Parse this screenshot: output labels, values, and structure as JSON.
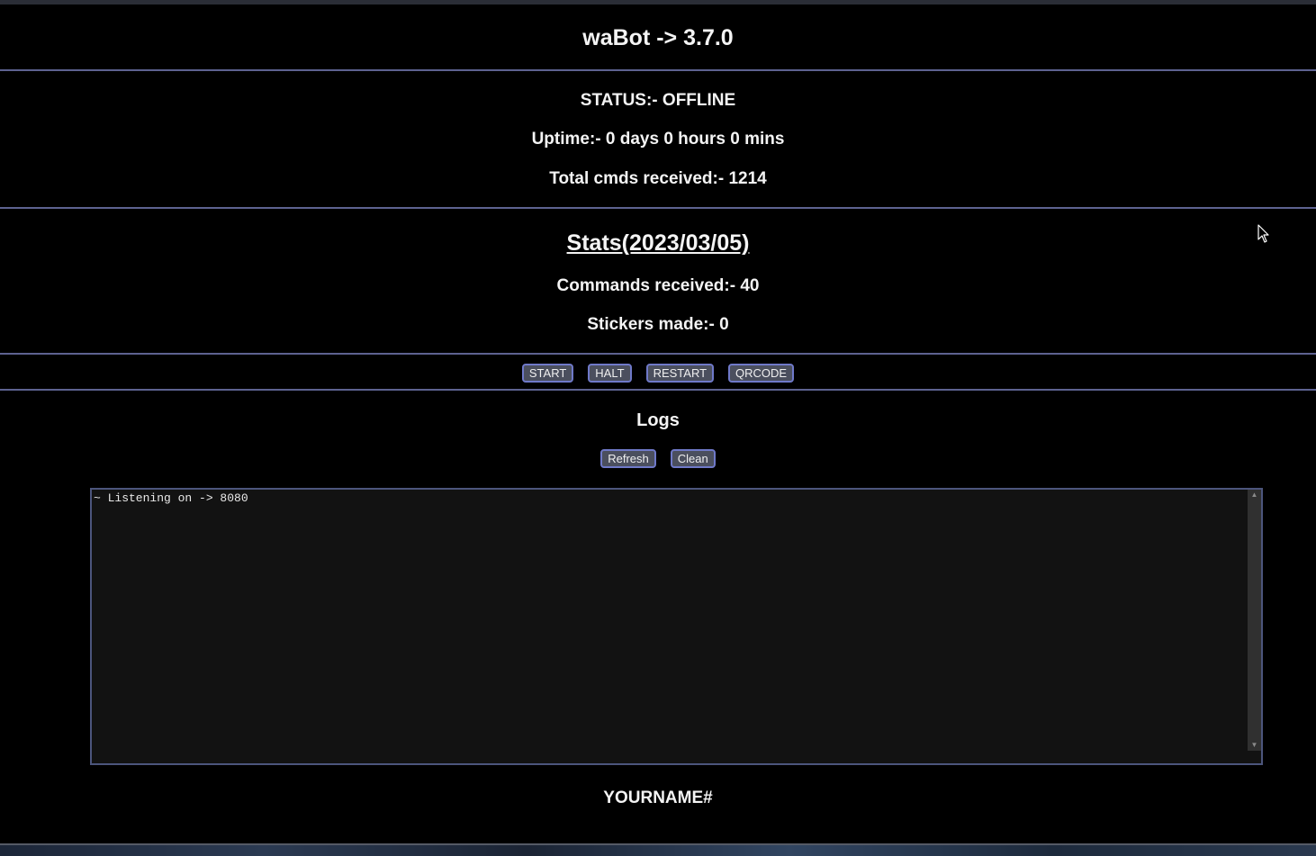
{
  "header": {
    "title": "waBot -> 3.7.0"
  },
  "status": {
    "status_text": "STATUS:- OFFLINE",
    "uptime_text": "Uptime:- 0 days 0 hours 0 mins",
    "total_cmds_text": "Total cmds received:- 1214"
  },
  "stats": {
    "heading": "Stats(2023/03/05)",
    "commands_text": "Commands received:- 40",
    "stickers_text": "Stickers made:- 0"
  },
  "controls": {
    "start_label": "START",
    "halt_label": "HALT",
    "restart_label": "RESTART",
    "qrcode_label": "QRCODE"
  },
  "logs": {
    "heading": "Logs",
    "refresh_label": "Refresh",
    "clean_label": "Clean",
    "content": "~ Listening on -> 8080"
  },
  "footer": {
    "text": "YOURNAME#"
  },
  "colors": {
    "background": "#000000",
    "divider": "#5d6290",
    "button_bg": "#4b4f5e",
    "button_border": "#6f79c9",
    "log_bg": "#121212"
  },
  "icons": {
    "cursor": "mouse-pointer-icon"
  }
}
